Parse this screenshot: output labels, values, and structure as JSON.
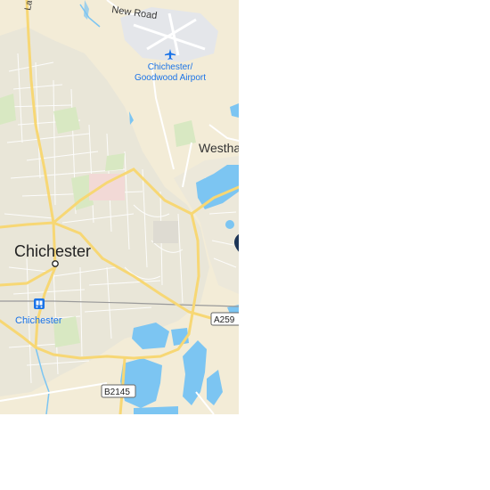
{
  "map": {
    "labels": {
      "city": "Chichester",
      "station": "Chichester",
      "airport_line1": "Chichester/",
      "airport_line2": "Goodwood Airport",
      "town_partial": "Westha",
      "road_top_left": "Lav",
      "road_north": "New Road"
    },
    "road_shields": {
      "a259": "A259",
      "b2145": "B2145"
    },
    "icons": {
      "location_pin": "location-pin-icon",
      "airport": "airport-icon",
      "train_station": "train-icon",
      "city_marker": "city-dot-icon"
    },
    "colors": {
      "land": "#f3ecd7",
      "urban": "#e9e6d8",
      "park": "#d8e8c2",
      "water": "#7cc5f2",
      "major_road": "#f7d774",
      "minor_road": "#ffffff",
      "airport_area": "#e4e6ea",
      "pin": "#1d3557",
      "transit_label": "#1a73e8",
      "label": "#222222"
    }
  }
}
